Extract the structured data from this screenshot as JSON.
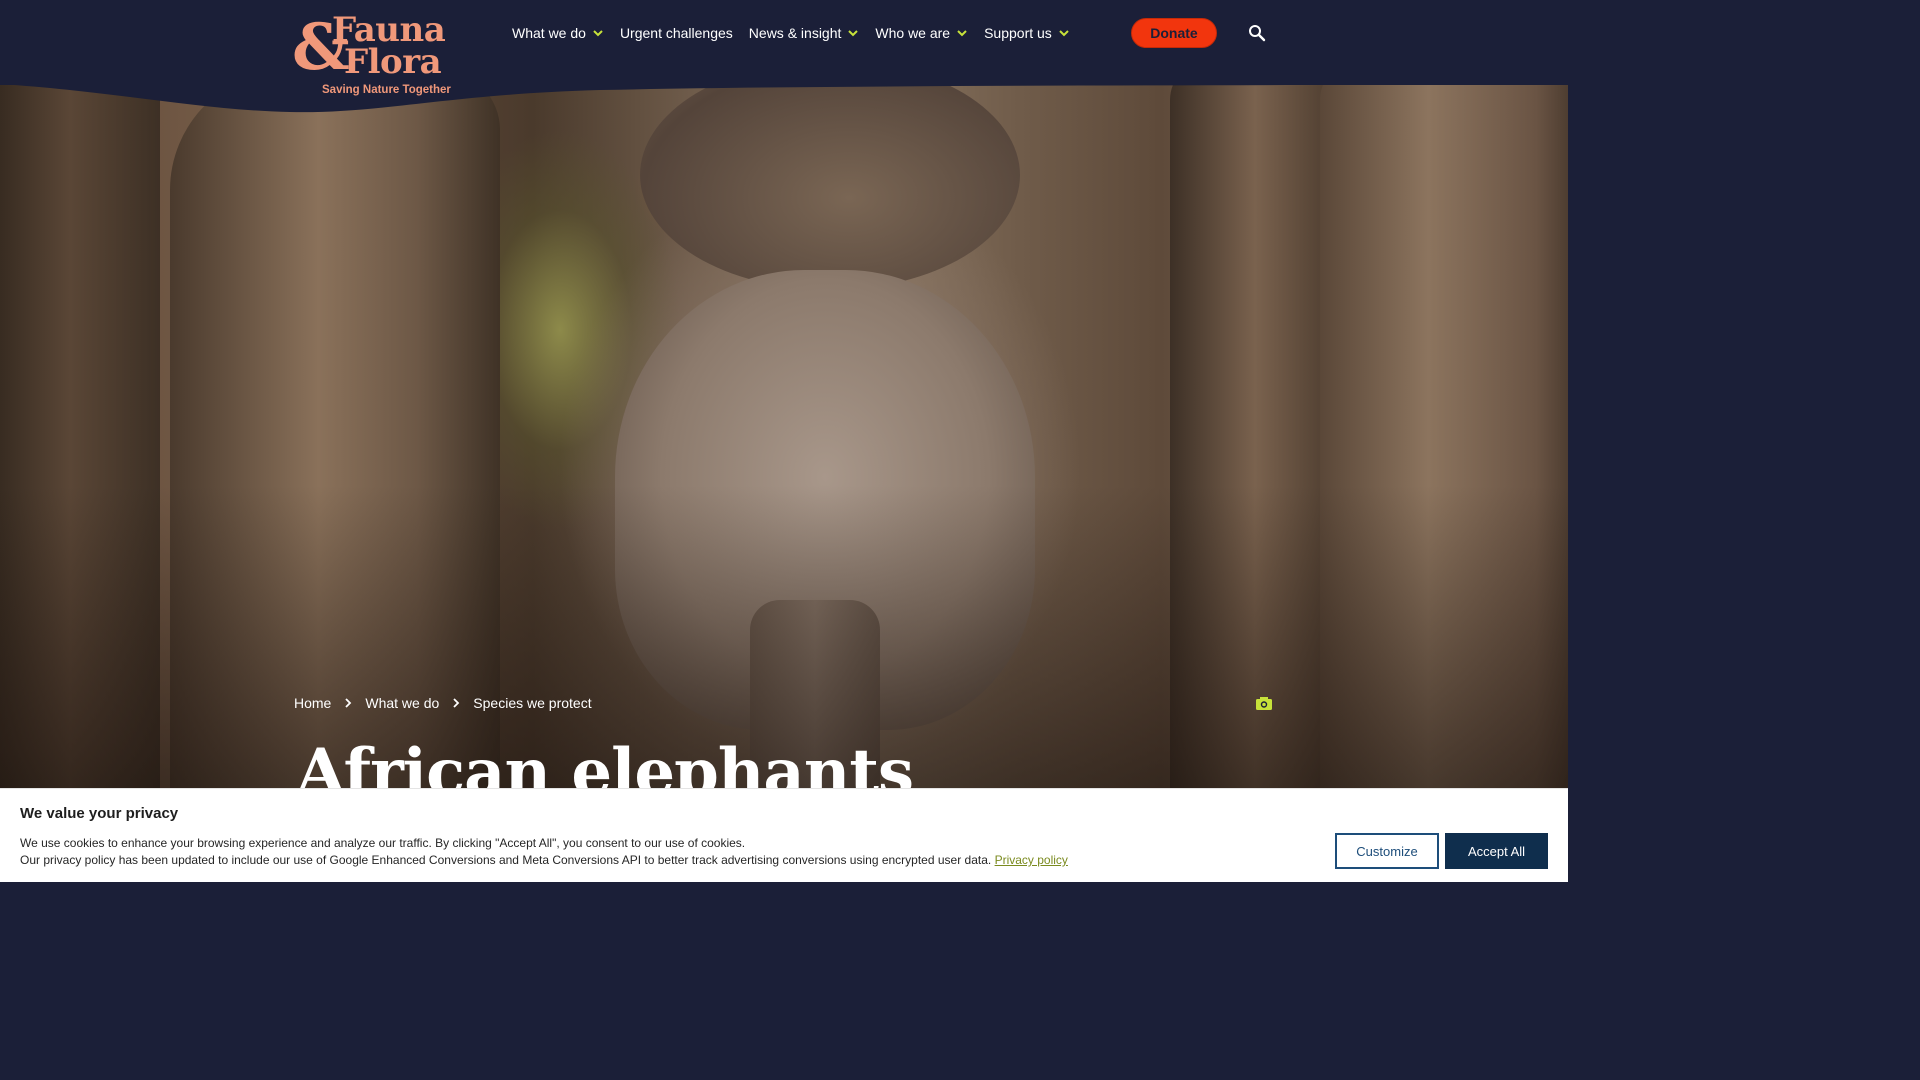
{
  "brand": {
    "logo_amp": "&",
    "logo_line1": "Fauna",
    "logo_line2": "Flora",
    "tagline": "Saving Nature Together",
    "accent_color": "#f0987a",
    "nav_bg": "#1b1f38"
  },
  "nav": {
    "items": [
      {
        "label": "What we do",
        "has_dropdown": true
      },
      {
        "label": "Urgent challenges",
        "has_dropdown": false
      },
      {
        "label": "News & insight",
        "has_dropdown": true
      },
      {
        "label": "Who we are",
        "has_dropdown": true
      },
      {
        "label": "Support us",
        "has_dropdown": true
      }
    ],
    "donate_label": "Donate",
    "donate_color": "#f2350d",
    "search_icon": "search-icon"
  },
  "breadcrumb": {
    "items": [
      "Home",
      "What we do",
      "Species we protect"
    ]
  },
  "hero": {
    "title": "African elephants",
    "photo_credit_icon": "camera-icon"
  },
  "cookie_banner": {
    "title": "We value your privacy",
    "line1": "We use cookies to enhance your browsing experience and analyze our traffic. By clicking \"Accept All\", you consent to our use of cookies.",
    "line2": "Our privacy policy has been updated to include our use of Google Enhanced Conversions and Meta Conversions API to better track advertising conversions using encrypted user data.",
    "policy_link": "Privacy policy",
    "customize_label": "Customize",
    "accept_label": "Accept All"
  }
}
